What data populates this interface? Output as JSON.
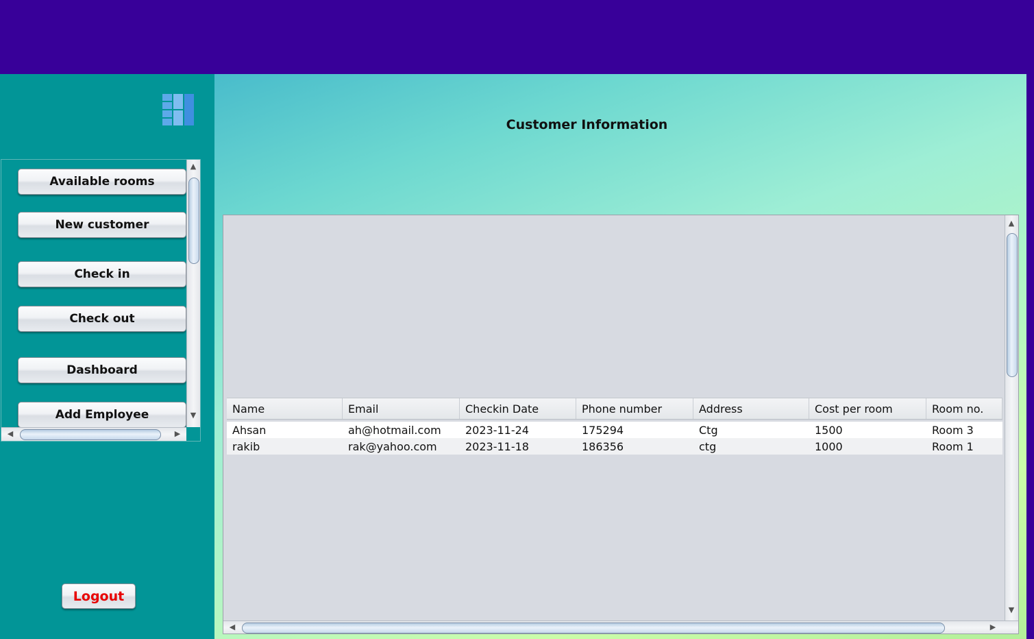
{
  "sidebar": {
    "logo_icon": "dashboard-grid-icon",
    "items": [
      {
        "label": "Available rooms"
      },
      {
        "label": "New customer"
      },
      {
        "label": "Check in"
      },
      {
        "label": "Check out"
      },
      {
        "label": "Dashboard"
      },
      {
        "label": "Add Employee"
      }
    ],
    "logout_label": "Logout"
  },
  "main": {
    "title": "Customer Information",
    "table": {
      "columns": [
        "Name",
        "Email",
        "Checkin Date",
        "Phone number",
        "Address",
        "Cost per room",
        "Room no."
      ],
      "rows": [
        [
          "Ahsan",
          "ah@hotmail.com",
          "2023-11-24",
          "175294",
          "Ctg",
          "1500",
          "Room 3"
        ],
        [
          "rakib",
          "rak@yahoo.com",
          "2023-11-18",
          "186356",
          "ctg",
          "1000",
          "Room 1"
        ]
      ]
    }
  },
  "scroll_icons": {
    "up": "▲",
    "down": "▼",
    "left": "◀",
    "right": "▶"
  },
  "colors": {
    "topbar": "#380099",
    "sidebar": "#029597",
    "logout_text": "#e80000"
  }
}
